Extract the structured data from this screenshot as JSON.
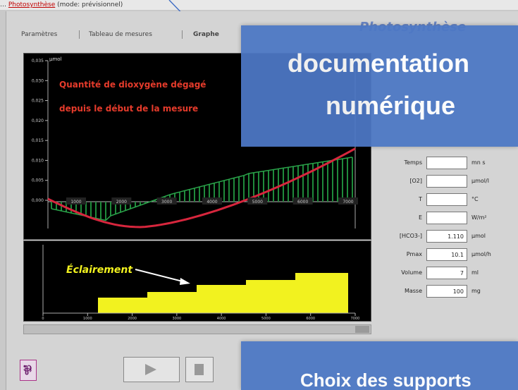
{
  "topbar": {
    "prefix": "…",
    "highlighted": "Photosynthèse",
    "rest": " (mode: prévisionnel)"
  },
  "tabs": [
    "Paramètres",
    "Tableau de mesures",
    "Graphe"
  ],
  "panel_title": "Photosynthèse",
  "upper_chart": {
    "annotation_line1": "Quantité de dioxygène dégagé",
    "annotation_line2": "depuis le début de la mesure",
    "y_ticks": [
      "0,000",
      "0,005",
      "0,010",
      "0,015",
      "0,020",
      "0,025",
      "0,030",
      "0,035"
    ],
    "x_ticks": [
      "1000",
      "2000",
      "3000",
      "4000",
      "5000",
      "6000",
      "7000"
    ],
    "unit_label": "µmol"
  },
  "lower_chart": {
    "annotation": "Éclairement",
    "x_ticks": [
      "0",
      "1000",
      "2000",
      "3000",
      "4000",
      "5000",
      "6000",
      "7000"
    ]
  },
  "params": [
    {
      "label": "Temps",
      "value": "",
      "unit": "mn s"
    },
    {
      "label": "[O2]",
      "value": "",
      "unit": "µmol/l"
    },
    {
      "label": "T",
      "value": "",
      "unit": "°C"
    },
    {
      "label": "E",
      "value": "",
      "unit": "W/m²"
    },
    {
      "label": "[HCO3-]",
      "value": "1.110",
      "unit": "µmol"
    },
    {
      "label": "Pmax",
      "value": "10.1",
      "unit": "µmol/h"
    },
    {
      "label": "Volume",
      "value": "7",
      "unit": "ml"
    },
    {
      "label": "Masse",
      "value": "100",
      "unit": "mg"
    }
  ],
  "overlays": {
    "top_line1": "documentation",
    "top_line2": "numérique",
    "bottom_line1": "Choix des supports"
  },
  "colors": {
    "overlay": "#4d78c5",
    "plot_bg": "#000000",
    "o2_curve": "#d7263d",
    "o2_bars": "#1f8a3b",
    "light_fill": "#f2f21f",
    "annotation": "#e53b2b"
  }
}
